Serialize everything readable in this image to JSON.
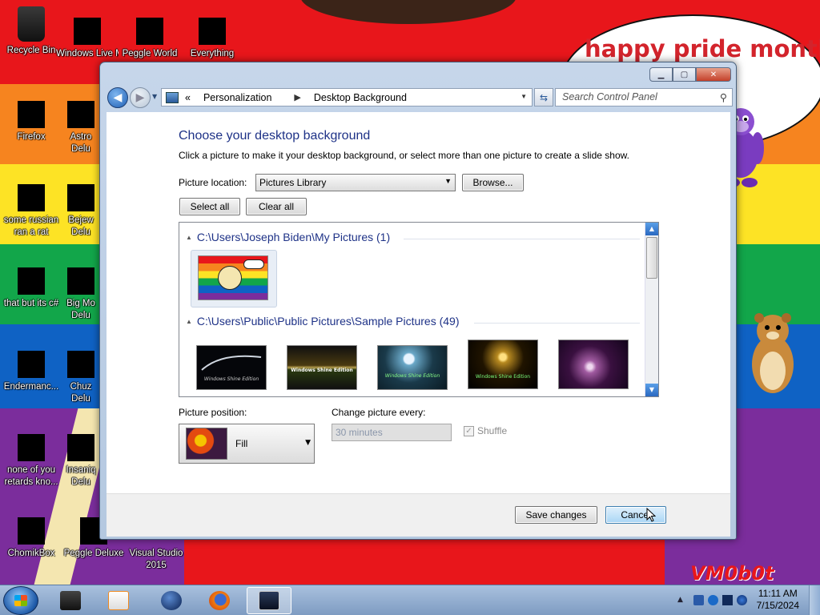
{
  "desktop": {
    "banner": "happy pride month",
    "watermark": "VM0b0t",
    "icons": [
      {
        "label": "Recycle Bin",
        "icon": "recycle-bin-icon"
      },
      {
        "label": "Windows Live Ma",
        "icon": "windows-live-mail-icon"
      },
      {
        "label": "Peggle World",
        "icon": "peggle-world-icon"
      },
      {
        "label": "Everything",
        "icon": "everything-search-icon"
      },
      {
        "label": "Firefox",
        "icon": "firefox-icon"
      },
      {
        "label": "Astro Delu",
        "icon": "astro-deluxe-icon"
      },
      {
        "label": "some russian ran a rat",
        "icon": "game-icon"
      },
      {
        "label": "Bejew Delu",
        "icon": "bejeweled-deluxe-icon"
      },
      {
        "label": "that but its c#",
        "icon": "program-icon"
      },
      {
        "label": "Big Mo Delu",
        "icon": "big-money-deluxe-icon"
      },
      {
        "label": "Endermanc...",
        "icon": "endermanch-icon"
      },
      {
        "label": "Chuz Delu",
        "icon": "chuzzle-deluxe-icon"
      },
      {
        "label": "none of you retards kno...",
        "icon": "program-icon"
      },
      {
        "label": "Insaniq Delu",
        "icon": "insaniquarium-deluxe-icon"
      },
      {
        "label": "ChomikBox",
        "icon": "chomikbox-icon"
      },
      {
        "label": "Peggle Deluxe",
        "icon": "peggle-deluxe-icon"
      },
      {
        "label": "Visual Studio 2015",
        "icon": "visual-studio-icon"
      }
    ]
  },
  "window": {
    "breadcrumb": [
      "Personalization",
      "Desktop Background"
    ],
    "breadcrumb_overflow": "«",
    "search_placeholder": "Search Control Panel",
    "heading": "Choose your desktop background",
    "instructions": "Click a picture to make it your desktop background, or select more than one picture to create a slide show.",
    "picture_location_label": "Picture location:",
    "picture_location_value": "Pictures Library",
    "browse_label": "Browse...",
    "select_all_label": "Select all",
    "clear_all_label": "Clear all",
    "groups": [
      {
        "title": "C:\\Users\\Joseph Biden\\My Pictures (1)",
        "thumbnails": [
          "pride-rainbow-cartoon"
        ]
      },
      {
        "title": "C:\\Users\\Public\\Public Pictures\\Sample Pictures (49)",
        "thumbnails": [
          "Windows Shine Edition",
          "Windows Shine Edition",
          "Windows Shine Edition",
          "Windows Shine Edition",
          ""
        ]
      }
    ],
    "picture_position_label": "Picture position:",
    "picture_position_value": "Fill",
    "change_every_label": "Change picture every:",
    "change_every_value": "30 minutes",
    "shuffle_label": "Shuffle",
    "shuffle_checked": true,
    "save_label": "Save changes",
    "cancel_label": "Cancel"
  },
  "taskbar": {
    "time": "11:11 AM",
    "date": "7/15/2024",
    "pinned": [
      "program-icon",
      "media-player-icon",
      "browser-icon",
      "firefox-icon",
      "control-panel-icon"
    ]
  },
  "colors": {
    "heading": "#1e3287",
    "taskbar": "#8fabd0",
    "window_frame": "#b9cbe2"
  }
}
